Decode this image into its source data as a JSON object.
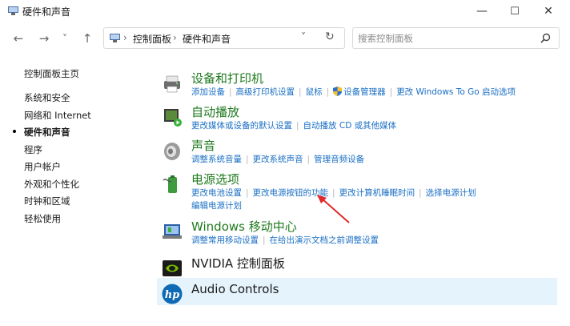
{
  "window": {
    "title": "硬件和声音",
    "minimize": "—",
    "maximize": "☐",
    "close": "✕"
  },
  "nav": {
    "back": "←",
    "forward": "→",
    "recent": "˅",
    "up": "↑",
    "breadcrumb": [
      "控制面板",
      "硬件和声音"
    ],
    "dropdown": "˅",
    "refresh": "↻",
    "search_placeholder": "搜索控制面板"
  },
  "sidebar": {
    "items": [
      {
        "label": "控制面板主页"
      },
      {
        "label": "系统和安全"
      },
      {
        "label": "网络和 Internet"
      },
      {
        "label": "硬件和声音",
        "active": true
      },
      {
        "label": "程序"
      },
      {
        "label": "用户帐户"
      },
      {
        "label": "外观和个性化"
      },
      {
        "label": "时钟和区域"
      },
      {
        "label": "轻松使用"
      }
    ]
  },
  "categories": [
    {
      "title": "设备和打印机",
      "icon": "printer-icon",
      "links": [
        "添加设备",
        "高级打印机设置",
        "鼠标",
        "设备管理器",
        "更改 Windows To Go 启动选项"
      ]
    },
    {
      "title": "自动播放",
      "icon": "autoplay-icon",
      "links": [
        "更改媒体或设备的默认设置",
        "自动播放 CD 或其他媒体"
      ]
    },
    {
      "title": "声音",
      "icon": "speaker-icon",
      "links": [
        "调整系统音量",
        "更改系统声音",
        "管理音频设备"
      ]
    },
    {
      "title": "电源选项",
      "icon": "battery-icon",
      "links": [
        "更改电池设置",
        "更改电源按钮的功能",
        "更改计算机睡眠时间",
        "选择电源计划"
      ],
      "links2": [
        "编辑电源计划"
      ]
    },
    {
      "title": "Windows 移动中心",
      "icon": "mobility-center-icon",
      "links": [
        "调整常用移动设置",
        "在给出演示文档之前调整设置"
      ]
    },
    {
      "title": "NVIDIA 控制面板",
      "icon": "nvidia-icon",
      "links": []
    },
    {
      "title": "Audio Controls",
      "icon": "hp-icon",
      "links": []
    }
  ],
  "colors": {
    "category_title": "#1e7a1e",
    "link": "#1a6fc4",
    "hover_background": "#e5f3fd",
    "arrow": "#e02a2a"
  }
}
